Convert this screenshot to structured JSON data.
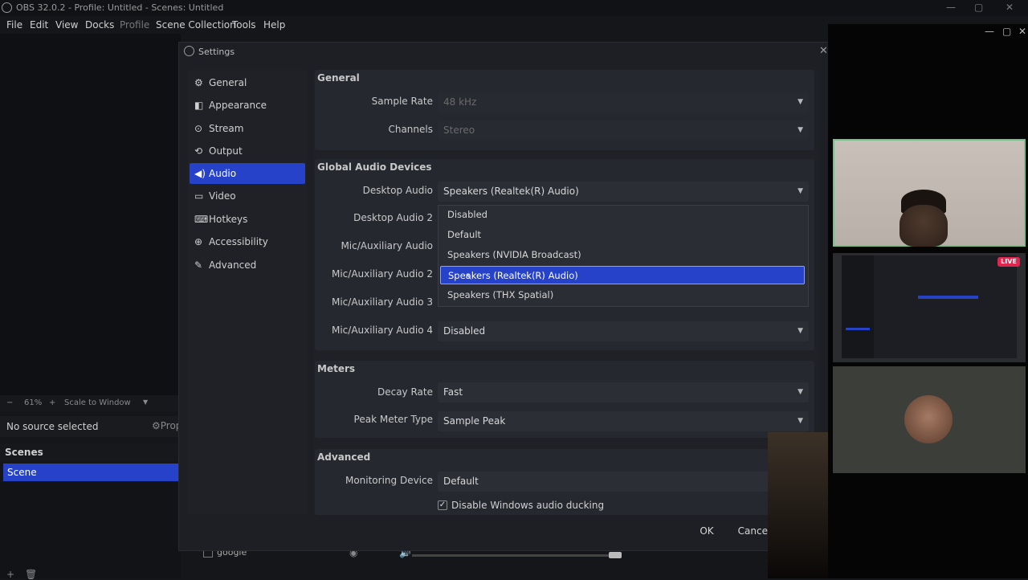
{
  "window": {
    "title": "OBS 32.0.2 - Profile: Untitled - Scenes: Untitled"
  },
  "menu": [
    "File",
    "Edit",
    "View",
    "Docks",
    "Profile",
    "Scene Collection",
    "Tools",
    "Help"
  ],
  "preview": {
    "zoom": "61%",
    "scale_mode": "Scale to Window",
    "no_source": "No source selected",
    "properties_label": "Prop"
  },
  "scenes": {
    "header": "Scenes",
    "items": [
      "Scene"
    ]
  },
  "sources": {
    "item": "google"
  },
  "settings": {
    "title": "Settings",
    "nav": [
      {
        "label": "General",
        "icon": "gear-icon"
      },
      {
        "label": "Appearance",
        "icon": "appearance-icon"
      },
      {
        "label": "Stream",
        "icon": "stream-icon"
      },
      {
        "label": "Output",
        "icon": "output-icon"
      },
      {
        "label": "Audio",
        "icon": "speaker-icon"
      },
      {
        "label": "Video",
        "icon": "monitor-icon"
      },
      {
        "label": "Hotkeys",
        "icon": "keyboard-icon"
      },
      {
        "label": "Accessibility",
        "icon": "accessibility-icon"
      },
      {
        "label": "Advanced",
        "icon": "wrench-icon"
      }
    ],
    "active_nav": "Audio",
    "general": {
      "title": "General",
      "sample_rate_label": "Sample Rate",
      "sample_rate": "48 kHz",
      "channels_label": "Channels",
      "channels": "Stereo"
    },
    "global_audio": {
      "title": "Global Audio Devices",
      "desktop_audio_label": "Desktop Audio",
      "desktop_audio": "Speakers (Realtek(R) Audio)",
      "desktop_audio_2_label": "Desktop Audio 2",
      "mic_label": "Mic/Auxiliary Audio",
      "mic2_label": "Mic/Auxiliary Audio 2",
      "mic3_label": "Mic/Auxiliary Audio 3",
      "mic4_label": "Mic/Auxiliary Audio 4",
      "mic4": "Disabled"
    },
    "dropdown": {
      "options": [
        "Disabled",
        "Default",
        "Speakers (NVIDIA Broadcast)",
        "Speakers (Realtek(R) Audio)",
        "Speakers (THX Spatial)"
      ],
      "selected": "Speakers (Realtek(R) Audio)"
    },
    "meters": {
      "title": "Meters",
      "decay_rate_label": "Decay Rate",
      "decay_rate": "Fast",
      "peak_meter_label": "Peak Meter Type",
      "peak_meter": "Sample Peak"
    },
    "advanced": {
      "title": "Advanced",
      "monitoring_label": "Monitoring Device",
      "monitoring": "Default",
      "ducking_label": "Disable Windows audio ducking",
      "ducking_checked": true
    },
    "buttons": {
      "ok": "OK",
      "cancel": "Cancel"
    }
  },
  "call": {
    "live_badge": "LIVE",
    "accent": "#79c08b"
  },
  "colors": {
    "accent": "#2642c9",
    "live": "#e0264f"
  }
}
